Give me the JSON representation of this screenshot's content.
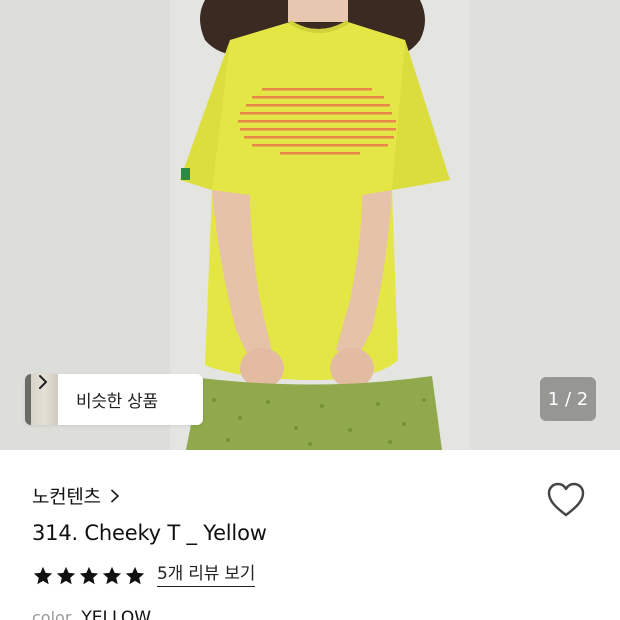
{
  "gallery": {
    "similar_products_label": "비슷한 상품",
    "page_indicator": "1 / 2"
  },
  "product": {
    "brand": "노컨텐츠",
    "title": "314. Cheeky T _ Yellow",
    "rating": 5,
    "rating_max": 5,
    "review_link": "5개 리뷰 보기",
    "option_label": "color",
    "option_value": "YELLOW"
  },
  "colors": {
    "shirt": "#e4e645",
    "shirt_print": "#e8774a",
    "skirt": "#8fa94c",
    "star": "#111111"
  },
  "icons": {
    "similar_chevron": "chevron-right-icon",
    "brand_chevron": "chevron-right-icon",
    "wishlist": "heart-outline-icon",
    "rating": "star-filled-icon"
  }
}
